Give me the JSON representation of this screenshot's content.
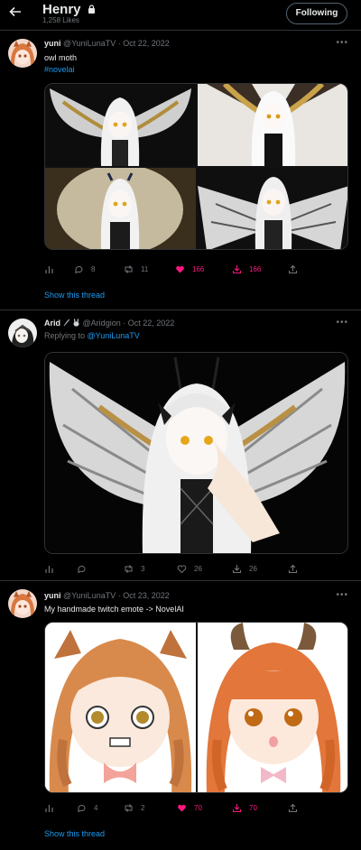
{
  "header": {
    "title": "Henry",
    "subtitle": "1,258 Likes",
    "follow_label": "Following"
  },
  "tweets": [
    {
      "name": "yuni",
      "handle": "@YuniLunaTV",
      "sep": "·",
      "date": "Oct 22, 2022",
      "text": "owl moth",
      "hashtag": "#novelai",
      "stats": {
        "replies": "8",
        "retweets": "11",
        "likes": "166",
        "downloads": "166"
      },
      "show_thread": "Show this thread"
    },
    {
      "name": "Arid",
      "handle": "@Aridgion",
      "sep": "·",
      "date": "Oct 22, 2022",
      "reply_prefix": "Replying to",
      "reply_to": "@YuniLunaTV",
      "stats": {
        "retweets": "3",
        "likes": "26",
        "downloads": "26"
      }
    },
    {
      "name": "yuni",
      "handle": "@YuniLunaTV",
      "sep": "·",
      "date": "Oct 23, 2022",
      "text": "My handmade twitch emote -> NovelAI",
      "stats": {
        "replies": "4",
        "retweets": "2",
        "likes": "70",
        "downloads": "70"
      },
      "show_thread": "Show this thread"
    }
  ],
  "colors": {
    "accent": "#1d9bf0",
    "like": "#f91880",
    "muted": "#71767b",
    "border": "#2f3336"
  },
  "icons": [
    "back-arrow-icon",
    "lock-icon",
    "more-icon",
    "analytics-icon",
    "reply-icon",
    "retweet-icon",
    "heart-icon",
    "download-icon",
    "share-icon"
  ]
}
